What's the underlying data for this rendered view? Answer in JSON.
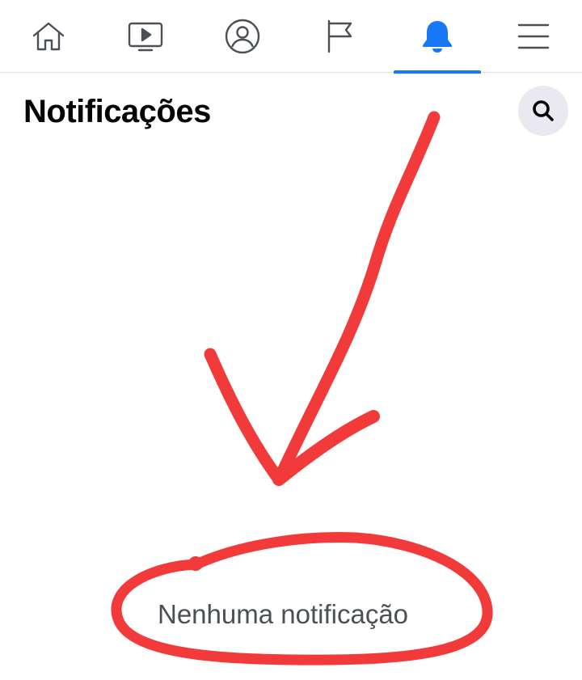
{
  "colors": {
    "accent": "#1877f2",
    "icon_inactive": "#4b4f56",
    "annotation": "#f23a3a"
  },
  "nav": {
    "items": [
      {
        "icon": "home-icon",
        "active": false
      },
      {
        "icon": "video-icon",
        "active": false
      },
      {
        "icon": "profile-icon",
        "active": false
      },
      {
        "icon": "pages-flag-icon",
        "active": false
      },
      {
        "icon": "notifications-bell-icon",
        "active": true
      },
      {
        "icon": "menu-icon",
        "active": false
      }
    ]
  },
  "header": {
    "title": "Notificações",
    "search_icon": "search-icon"
  },
  "main": {
    "empty_message": "Nenhuma notificação"
  }
}
